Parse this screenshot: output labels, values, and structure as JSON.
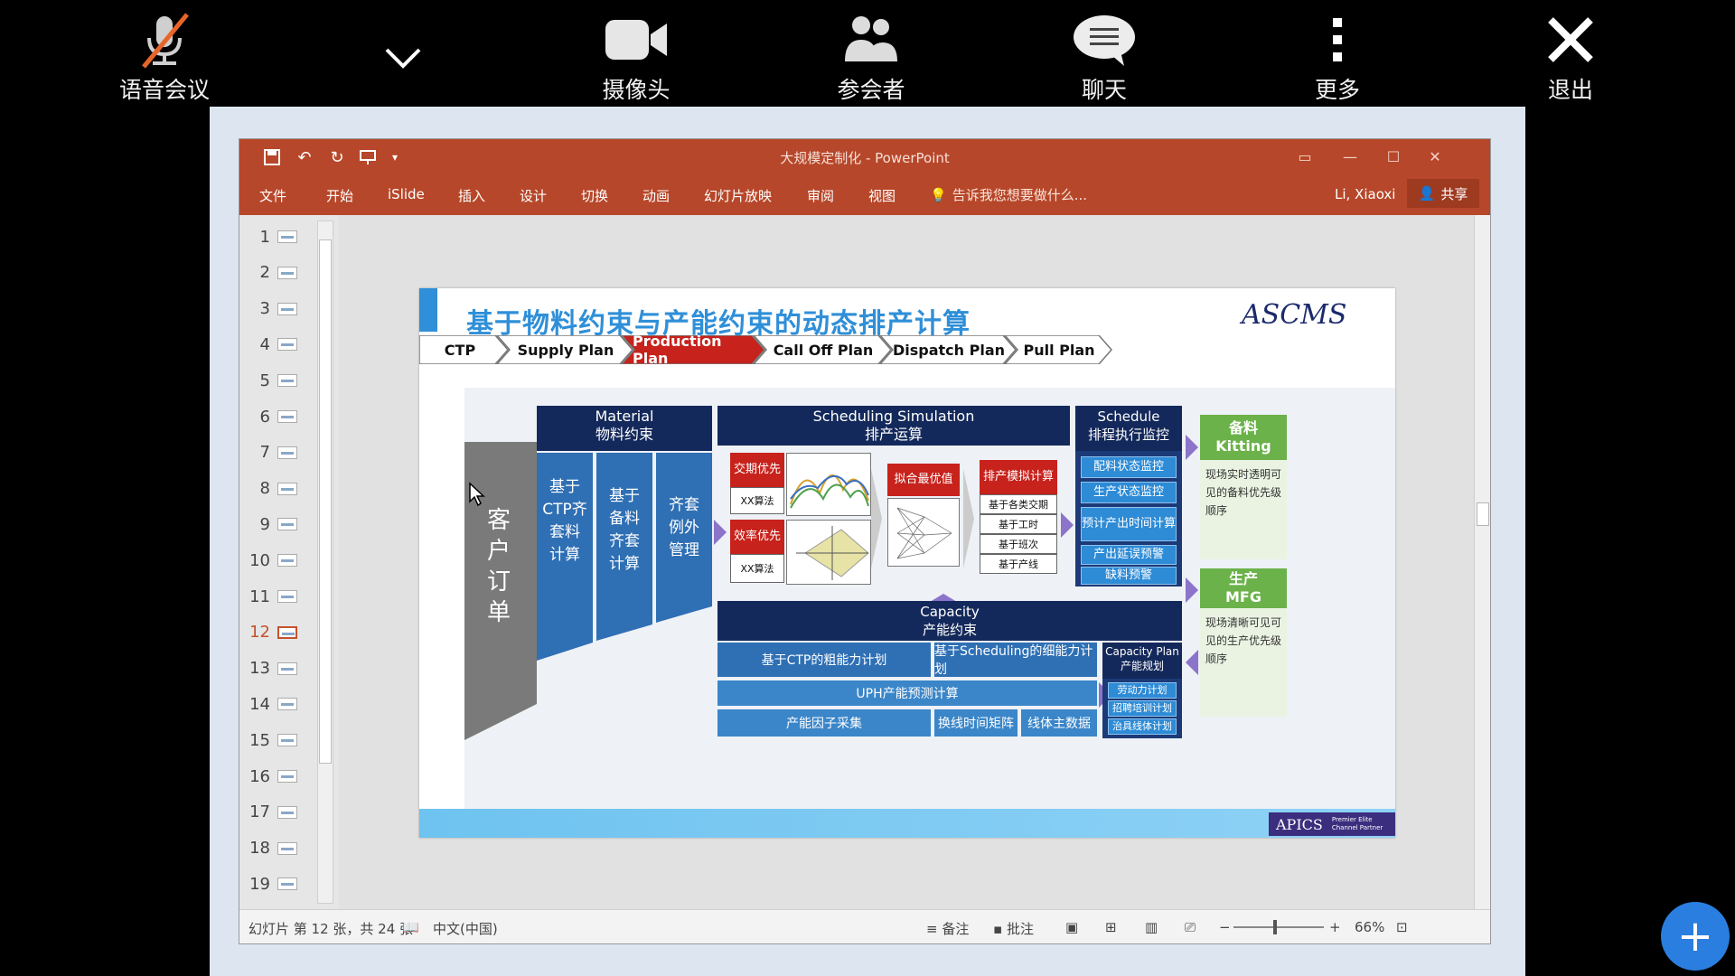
{
  "meeting_toolbar": {
    "voice": "语音会议",
    "camera": "摄像头",
    "participants": "参会者",
    "chat": "聊天",
    "more": "更多",
    "exit": "退出"
  },
  "ppt": {
    "window_title": "大规模定制化 - PowerPoint",
    "tabs": [
      "文件",
      "开始",
      "iSlide",
      "插入",
      "设计",
      "切换",
      "动画",
      "幻灯片放映",
      "审阅",
      "视图"
    ],
    "tell_me": "告诉我您想要做什么...",
    "user": "Li, Xiaoxi",
    "share": "共享",
    "slide_numbers": [
      "1",
      "2",
      "3",
      "4",
      "5",
      "6",
      "7",
      "8",
      "9",
      "10",
      "11",
      "12",
      "13",
      "14",
      "15",
      "16",
      "17",
      "18",
      "19"
    ],
    "active_slide": 12,
    "status": {
      "slide_info": "幻灯片 第 12 张，共 24 张",
      "language": "中文(中国)",
      "notes": "备注",
      "comments": "批注",
      "zoom": "66%"
    }
  },
  "slide": {
    "title": "基于物料约束与产能约束的动态排产计算",
    "logo": "ASCMS",
    "process_steps": [
      "CTP",
      "Supply Plan",
      "Production Plan",
      "Call Off Plan",
      "Dispatch Plan",
      "Pull Plan"
    ],
    "active_step": "Production Plan",
    "customer_order": "客户订单",
    "material_header": "Material",
    "material_header_cn": "物料约束",
    "material_cols": [
      "基于CTP齐套料计算",
      "基于备料齐套计算",
      "齐套例外管理"
    ],
    "sched_header": "Scheduling Simulation",
    "sched_header_cn": "排产运算",
    "delivery_first": "交期优先",
    "efficiency_first": "效率优先",
    "xx_algo": "XX算法",
    "fit_best": "拟合最优值",
    "sim_calc": "排产模拟计算",
    "sim_items": [
      "基于各类交期",
      "基于工时",
      "基于班次",
      "基于产线"
    ],
    "schedule_header": "Schedule",
    "schedule_header_cn": "排程执行监控",
    "monitor_items": [
      "配料状态监控",
      "生产状态监控",
      "预计产出时间计算",
      "产出延误预警",
      "缺料预警"
    ],
    "capacity_header": "Capacity",
    "capacity_header_cn": "产能约束",
    "capacity_row1": [
      "基于CTP的粗能力计划",
      "基于Scheduling的细能力计划"
    ],
    "uph": "UPH产能预测计算",
    "capacity_row3": [
      "产能因子采集",
      "换线时间矩阵",
      "线体主数据"
    ],
    "cap_plan_header": "Capacity Plan",
    "cap_plan_header_cn": "产能规划",
    "cap_plan_items": [
      "劳动力计划",
      "招聘培训计划",
      "治具线体计划"
    ],
    "kitting_title": "备料",
    "kitting_title_en": "Kitting",
    "kitting_desc": "现场实时透明可见的备料优先级顺序",
    "mfg_title": "生产",
    "mfg_title_en": "MFG",
    "mfg_desc": "现场清晰可见可见的生产优先级顺序",
    "apics": "APICS",
    "apics_sub": "Premier Elite Channel Partner"
  }
}
